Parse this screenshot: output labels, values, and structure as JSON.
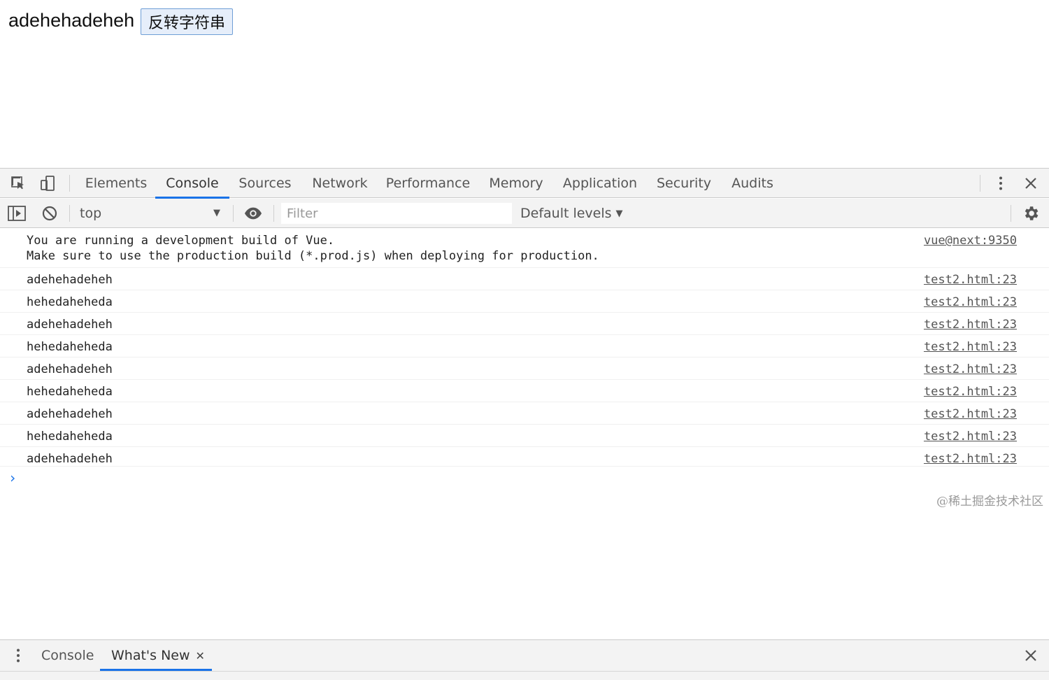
{
  "page": {
    "text": "adehehadeheh",
    "button_label": "反转字符串"
  },
  "devtools": {
    "tabs": [
      {
        "label": "Elements"
      },
      {
        "label": "Console",
        "active": true
      },
      {
        "label": "Sources"
      },
      {
        "label": "Network"
      },
      {
        "label": "Performance"
      },
      {
        "label": "Memory"
      },
      {
        "label": "Application"
      },
      {
        "label": "Security"
      },
      {
        "label": "Audits"
      }
    ],
    "toolbar": {
      "context": "top",
      "filter_placeholder": "Filter",
      "levels": "Default levels"
    },
    "messages": [
      {
        "text": "You are running a development build of Vue.\nMake sure to use the production build (*.prod.js) when deploying for production.",
        "source": "vue@next:9350"
      },
      {
        "text": "adehehadeheh",
        "source": "test2.html:23"
      },
      {
        "text": "hehedaheheda",
        "source": "test2.html:23"
      },
      {
        "text": "adehehadeheh",
        "source": "test2.html:23"
      },
      {
        "text": "hehedaheheda",
        "source": "test2.html:23"
      },
      {
        "text": "adehehadeheh",
        "source": "test2.html:23"
      },
      {
        "text": "hehedaheheda",
        "source": "test2.html:23"
      },
      {
        "text": "adehehadeheh",
        "source": "test2.html:23"
      },
      {
        "text": "hehedaheheda",
        "source": "test2.html:23"
      },
      {
        "text": "adehehadeheh",
        "source": "test2.html:23"
      }
    ],
    "prompt_symbol": "›",
    "drawer": {
      "tabs": [
        {
          "label": "Console"
        },
        {
          "label": "What's New",
          "active": true,
          "closable": true
        }
      ]
    }
  },
  "watermark": "@稀土掘金技术社区",
  "colors": {
    "accent": "#1a73e8",
    "panel_bg": "#f3f3f3",
    "border": "#cbcbcb"
  }
}
